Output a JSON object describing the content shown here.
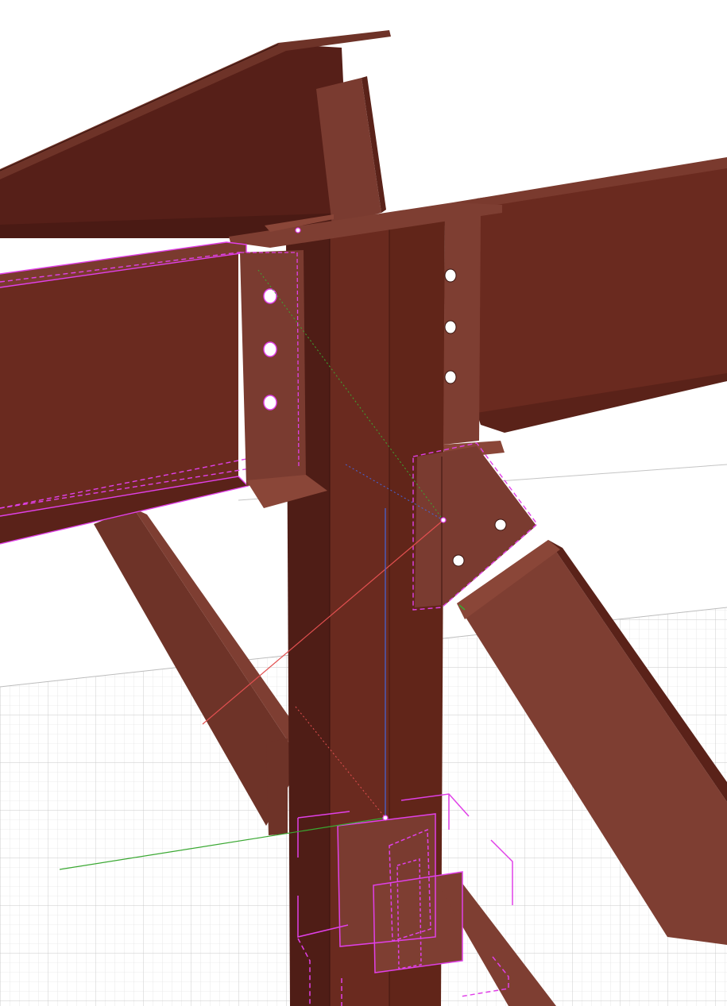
{
  "scene": {
    "view": "3d-perspective",
    "background_color": "#ffffff",
    "grid_color": "#d4d4d4",
    "steel_colors": {
      "dark": "#4f1d16",
      "mid": "#6a2a1f",
      "light": "#7e3e32",
      "edge": "#3a140f"
    },
    "selection_color": "#e040e8",
    "axis_colors": {
      "x": "#e25050",
      "y": "#3aa832",
      "z": "#4466dd"
    },
    "members": [
      {
        "name": "column",
        "kind": "i-section"
      },
      {
        "name": "roof-beam",
        "kind": "i-section"
      },
      {
        "name": "purlin-angle",
        "kind": "angle"
      },
      {
        "name": "beam-left",
        "kind": "i-section",
        "selected": true
      },
      {
        "name": "beam-right",
        "kind": "i-section"
      },
      {
        "name": "brace-left",
        "kind": "angle"
      },
      {
        "name": "brace-right",
        "kind": "angle"
      }
    ],
    "connections": [
      {
        "name": "shear-tab-left",
        "bolts": 3
      },
      {
        "name": "shear-tab-right",
        "bolts": 3
      },
      {
        "name": "gusset-plate",
        "bolts": 2
      },
      {
        "name": "base-connection"
      }
    ]
  }
}
